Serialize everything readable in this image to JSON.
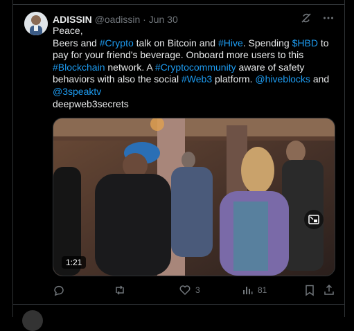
{
  "post": {
    "author_name": "ADISSIN",
    "author_handle": "@oadissin",
    "separator": "·",
    "date": "Jun 30",
    "text": {
      "line_greeting": "Peace,",
      "seg1": "Beers and ",
      "tag_crypto": "#Crypto",
      "seg2": " talk on Bitcoin and ",
      "tag_hive": "#Hive",
      "seg3": ". Spending ",
      "tag_hbd": "$HBD",
      "seg4": " to pay for your friend's beverage. Onboard more users to this ",
      "tag_blockchain": "#Blockchain",
      "seg5": " network. A ",
      "tag_cryptocommunity": "#Cryptocommunity",
      "seg6": " aware of safety behaviors with also the social ",
      "tag_web3": "#Web3",
      "seg7": " platform. ",
      "mention_hiveblocks": "@hiveblocks",
      "seg8": " and ",
      "mention_3speaktv": "@3speaktv",
      "line_last": "deepweb3secrets"
    },
    "video_duration": "1:21",
    "actions": {
      "replies": "",
      "reposts": "",
      "likes": "3",
      "views": "81"
    }
  },
  "icons": {
    "grok": "grok-icon",
    "more": "more-icon",
    "pip": "picture-in-picture-icon",
    "reply": "reply-icon",
    "repost": "repost-icon",
    "like": "heart-icon",
    "views": "views-icon",
    "bookmark": "bookmark-icon",
    "share": "share-icon"
  },
  "colors": {
    "background": "#000000",
    "text": "#e7e9ea",
    "muted": "#71767b",
    "accent": "#1d9bf0",
    "border": "#2f3336"
  }
}
